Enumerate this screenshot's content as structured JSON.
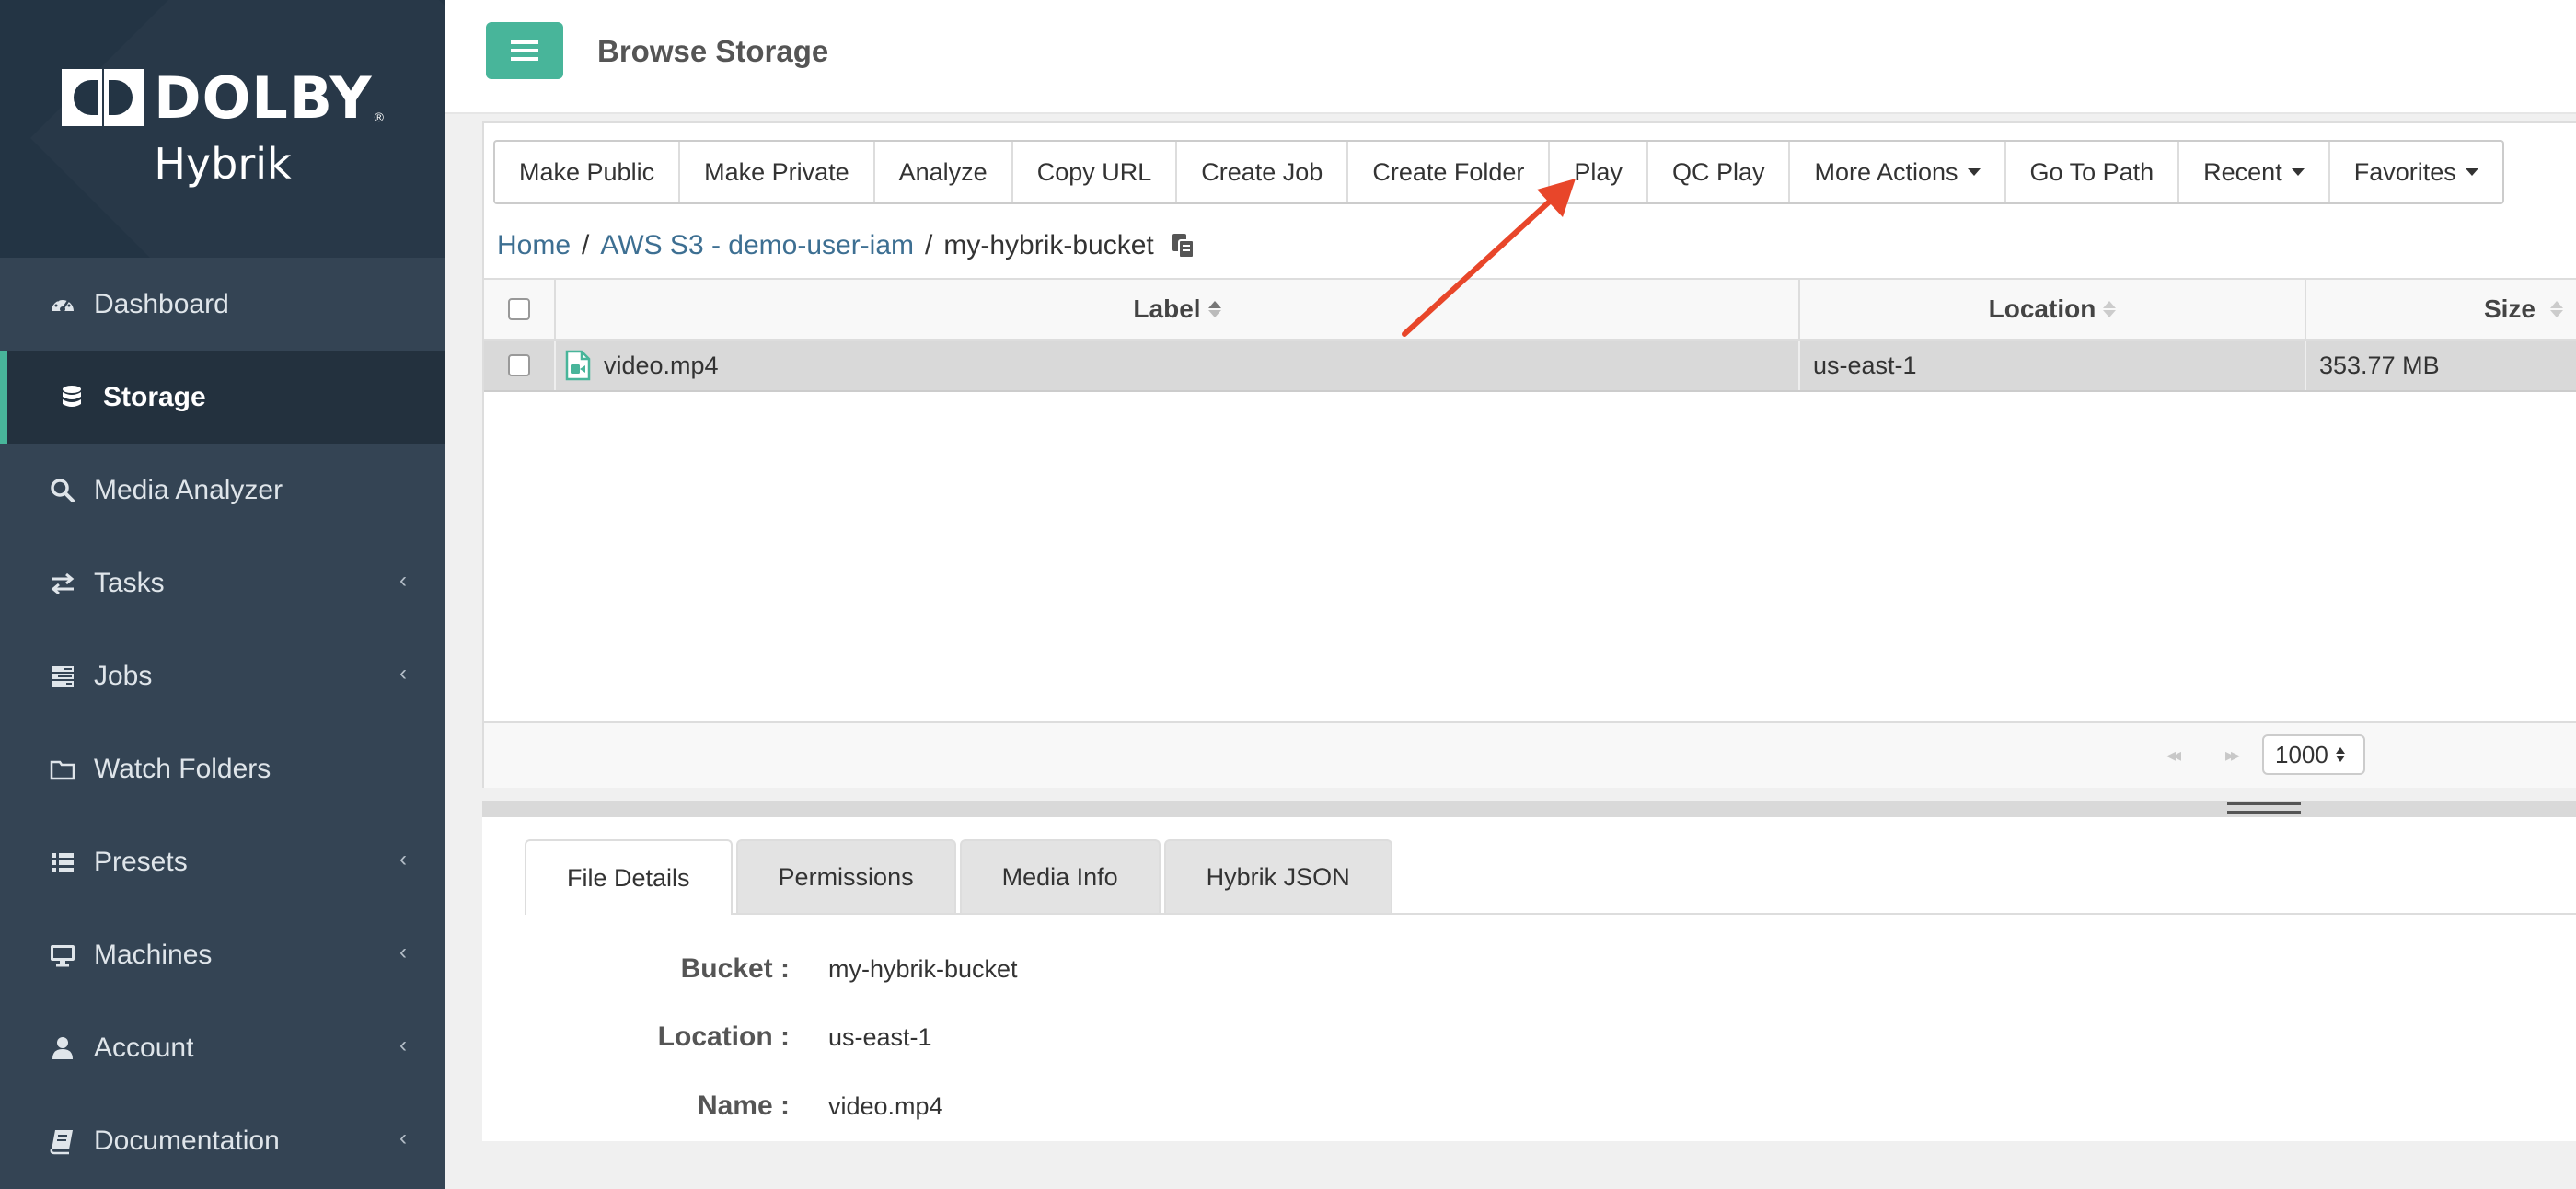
{
  "brand": {
    "name": "DOLBY",
    "registered": "®",
    "product": "Hybrik"
  },
  "sidebar": {
    "items": [
      {
        "label": "Dashboard",
        "icon": "dashboard-icon"
      },
      {
        "label": "Storage",
        "icon": "database-icon",
        "active": true
      },
      {
        "label": "Media Analyzer",
        "icon": "search-icon"
      },
      {
        "label": "Tasks",
        "icon": "exchange-icon",
        "chevron": "‹"
      },
      {
        "label": "Jobs",
        "icon": "tasks-icon",
        "chevron": "‹"
      },
      {
        "label": "Watch Folders",
        "icon": "folder-icon"
      },
      {
        "label": "Presets",
        "icon": "list-icon",
        "chevron": "‹"
      },
      {
        "label": "Machines",
        "icon": "desktop-icon",
        "chevron": "‹"
      },
      {
        "label": "Account",
        "icon": "user-icon",
        "chevron": "‹"
      },
      {
        "label": "Documentation",
        "icon": "book-icon",
        "chevron": "‹"
      }
    ]
  },
  "header": {
    "title": "Browse Storage"
  },
  "toolbar": {
    "buttons": [
      "Make Public",
      "Make Private",
      "Analyze",
      "Copy URL",
      "Create Job",
      "Create Folder",
      "Play",
      "QC Play",
      "More Actions",
      "Go To Path",
      "Recent",
      "Favorites"
    ]
  },
  "breadcrumb": {
    "home": "Home",
    "account": "AWS S3 - demo-user-iam",
    "current": "my-hybrik-bucket",
    "separator": "/"
  },
  "table": {
    "columns": {
      "label": "Label",
      "location": "Location",
      "size": "Size"
    },
    "rows": [
      {
        "label": "video.mp4",
        "location": "us-east-1",
        "size": "353.77 MB"
      }
    ]
  },
  "pager": {
    "page_size": "1000",
    "first": "◂◂",
    "next": "▸▸"
  },
  "details": {
    "tabs": [
      "File Details",
      "Permissions",
      "Media Info",
      "Hybrik JSON"
    ],
    "fields": [
      {
        "key": "Bucket :",
        "value": "my-hybrik-bucket"
      },
      {
        "key": "Location :",
        "value": "us-east-1"
      },
      {
        "key": "Name :",
        "value": "video.mp4"
      }
    ]
  },
  "colors": {
    "sidebar": "#344454",
    "brand_bg": "#233444",
    "accent": "#48b59a",
    "link": "#3d6f92",
    "annotation_arrow": "#e8462a"
  }
}
